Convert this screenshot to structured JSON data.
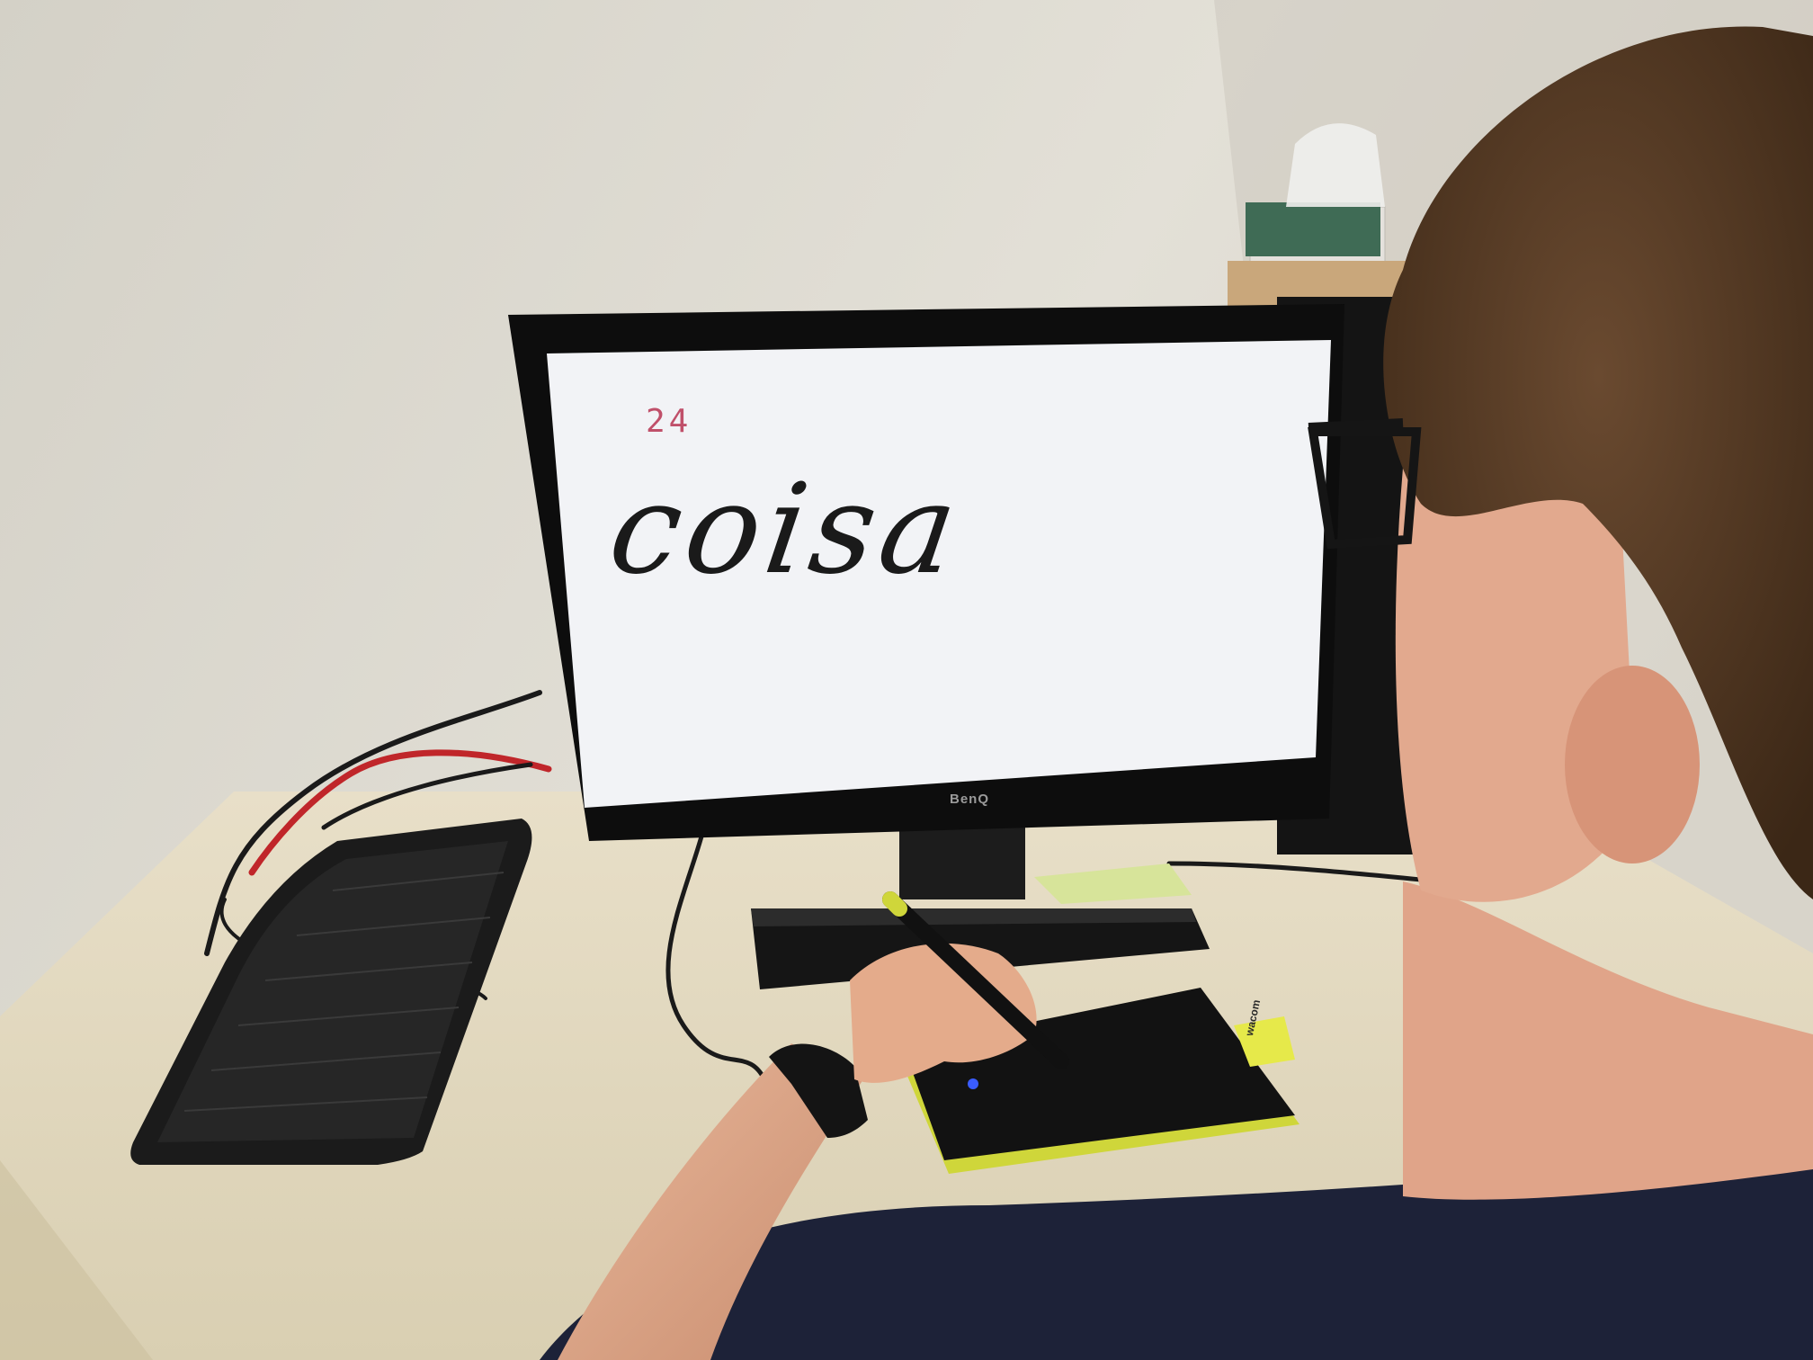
{
  "screen": {
    "counter": "24",
    "word": "coisa"
  },
  "monitor": {
    "brand": "BenQ"
  },
  "tablet": {
    "brand": "wacom"
  },
  "colors": {
    "wall": "#dcd9cf",
    "desk": "#e6dcc3",
    "screen_bg": "#f2f3f6",
    "counter_text": "#c0506a",
    "ink": "#1a1a1a",
    "tablet_accent": "#cfd63a",
    "shirt": "#1d2238",
    "hair": "#5b3f28"
  }
}
